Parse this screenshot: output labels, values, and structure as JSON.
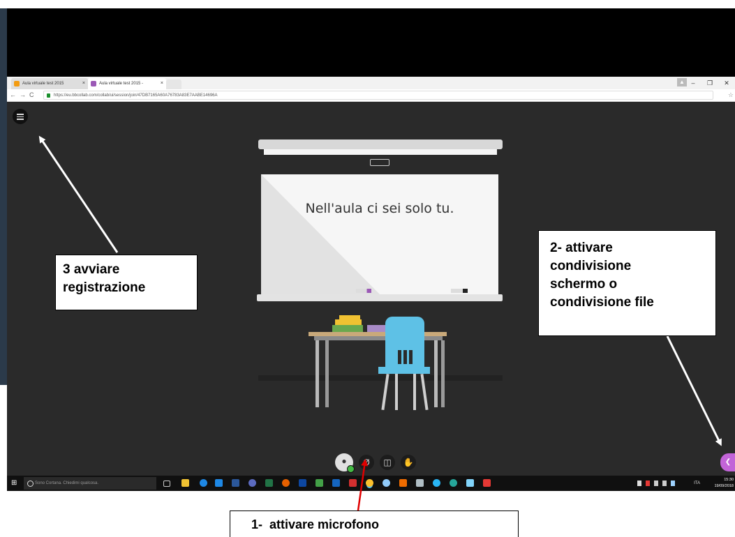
{
  "browser": {
    "tabs": [
      {
        "title": "Aula virtuale test 2015",
        "active": false,
        "favicon_color": "#f39c12"
      },
      {
        "title": "Aula virtuale test 2015 -",
        "active": true,
        "favicon_color": "#9b59b6"
      }
    ],
    "url": "https://eu.bbcollab.com/collab/ui/session/join/47DB7165A60A76783A83E7AABE14696A",
    "nav": {
      "back": "←",
      "forward": "→",
      "reload": "C"
    },
    "window_controls": {
      "minimize": "–",
      "maximize": "❐",
      "close": "✕"
    },
    "star": "☆"
  },
  "session": {
    "empty_room_text": "Nell'aula ci sei solo tu.",
    "controls": {
      "share": "❮"
    }
  },
  "taskbar": {
    "cortana_placeholder": "Sono Cortana. Chiedimi qualcosa.",
    "language": "ITA",
    "time": "15:30",
    "date": "19/09/2018"
  },
  "annotations": {
    "callout_recording": [
      "3 avviare",
      "registrazione"
    ],
    "callout_share": [
      "2- attivare",
      "condivisione",
      "schermo o",
      "condivisione file"
    ],
    "callout_microphone": "1-  attivare microfono"
  },
  "colors": {
    "stage_bg": "#2a2a2a",
    "arrow": "#ffffff",
    "mic_arrow": "#e00000",
    "collab_accent": "#c264d8",
    "mic_status": "#44bb44"
  }
}
